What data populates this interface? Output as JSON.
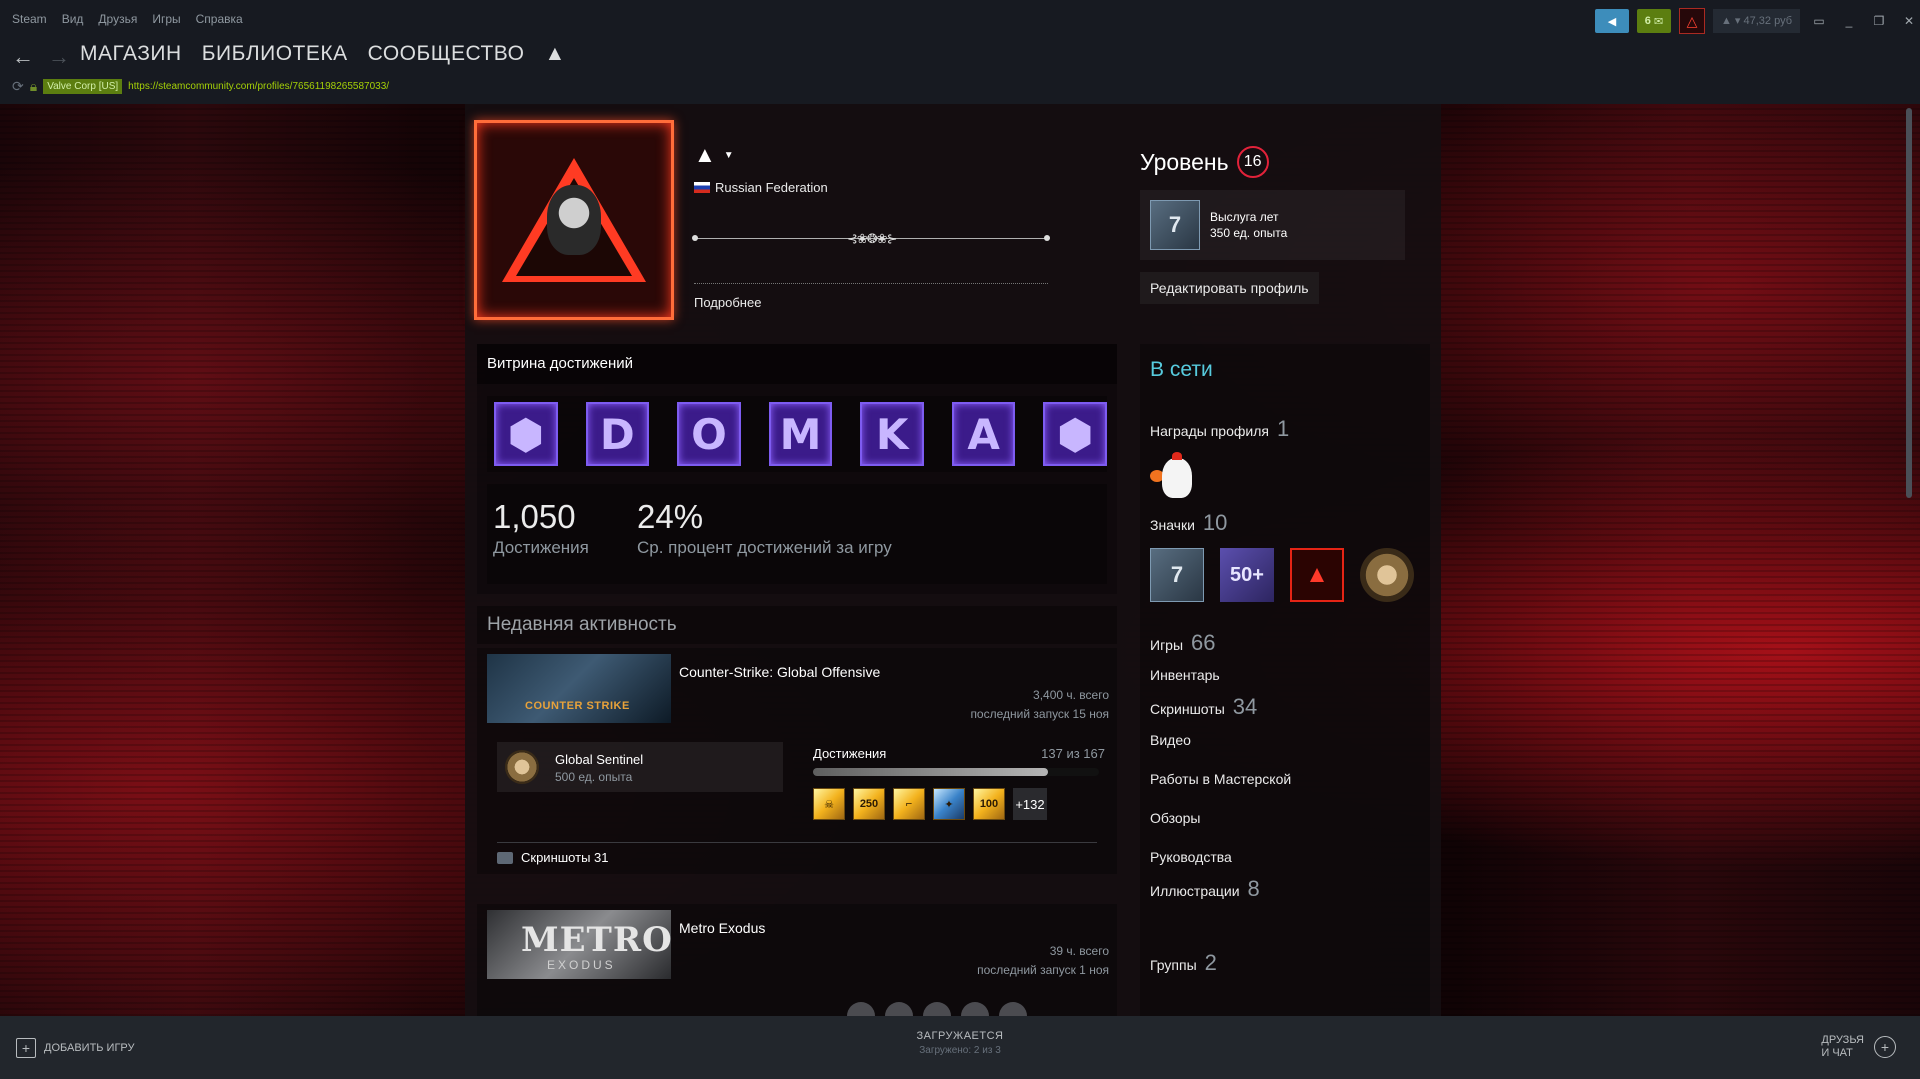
{
  "menu": [
    "Steam",
    "Вид",
    "Друзья",
    "Игры",
    "Справка"
  ],
  "titlebar": {
    "notif_count": "6",
    "wallet": "▲ ▾ 47,32 руб"
  },
  "nav": {
    "store": "МАГАЗИН",
    "library": "БИБЛИОТЕКА",
    "community": "СООБЩЕСТВО",
    "username": "▲"
  },
  "url": {
    "cert": "Valve Corp [US]",
    "address": "https://steamcommunity.com/profiles/76561198265587033/"
  },
  "profile": {
    "name": "▲",
    "country": "Russian Federation",
    "summary_ornament": "⊰❀❂❀⊱",
    "more": "Подробнее"
  },
  "level": {
    "label": "Уровень",
    "value": "16",
    "years_icon": "7",
    "years_title": "Выслуга лет",
    "years_xp": "350 ед. опыта",
    "edit": "Редактировать профиль"
  },
  "showcase": {
    "title": "Витрина достижений",
    "tiles": [
      "⬢",
      "D",
      "O",
      "M",
      "K",
      "A",
      "⬢"
    ],
    "achievements_count": "1,050",
    "achievements_label": "Достижения",
    "avg_percent": "24%",
    "avg_label": "Ср. процент достижений за игру"
  },
  "activity": {
    "title": "Недавняя активность",
    "game1": {
      "capsule_text": "COUNTER STRIKE",
      "name": "Counter-Strike: Global Offensive",
      "hours": "3,400 ч. всего",
      "last_played": "последний запуск 15 ноя",
      "badge_name": "Global Sentinel",
      "badge_xp": "500 ед. опыта",
      "ach_label": "Достижения",
      "ach_count": "137 из 167",
      "ach_progress": 0.82,
      "ach_icons": [
        "☠",
        "250",
        "⌐",
        "✦",
        "100"
      ],
      "ach_more": "+132",
      "screenshots": "Скриншоты 31"
    },
    "game2": {
      "capsule_text": "METRO",
      "capsule_sub": "EXODUS",
      "name": "Metro Exodus",
      "hours": "39 ч. всего",
      "last_played": "последний запуск 1 ноя"
    }
  },
  "sidebar": {
    "status": "В сети",
    "awards_label": "Награды профиля",
    "awards_count": "1",
    "badges_label": "Значки",
    "badges_count": "10",
    "badge_texts": [
      "7",
      "50+",
      "▲"
    ],
    "games_label": "Игры",
    "games_count": "66",
    "inventory": "Инвентарь",
    "screenshots_label": "Скриншоты",
    "screenshots_count": "34",
    "videos": "Видео",
    "workshop": "Работы в Мастерской",
    "reviews": "Обзоры",
    "guides": "Руководства",
    "artwork_label": "Иллюстрации",
    "artwork_count": "8",
    "groups_label": "Группы",
    "groups_count": "2"
  },
  "bottombar": {
    "add_game": "ДОБАВИТЬ ИГРУ",
    "loading": "ЗАГРУЖАЕТСЯ",
    "loading_sub": "Загружено: 2 из 3",
    "friends_line1": "ДРУЗЬЯ",
    "friends_line2": "И ЧАТ"
  }
}
